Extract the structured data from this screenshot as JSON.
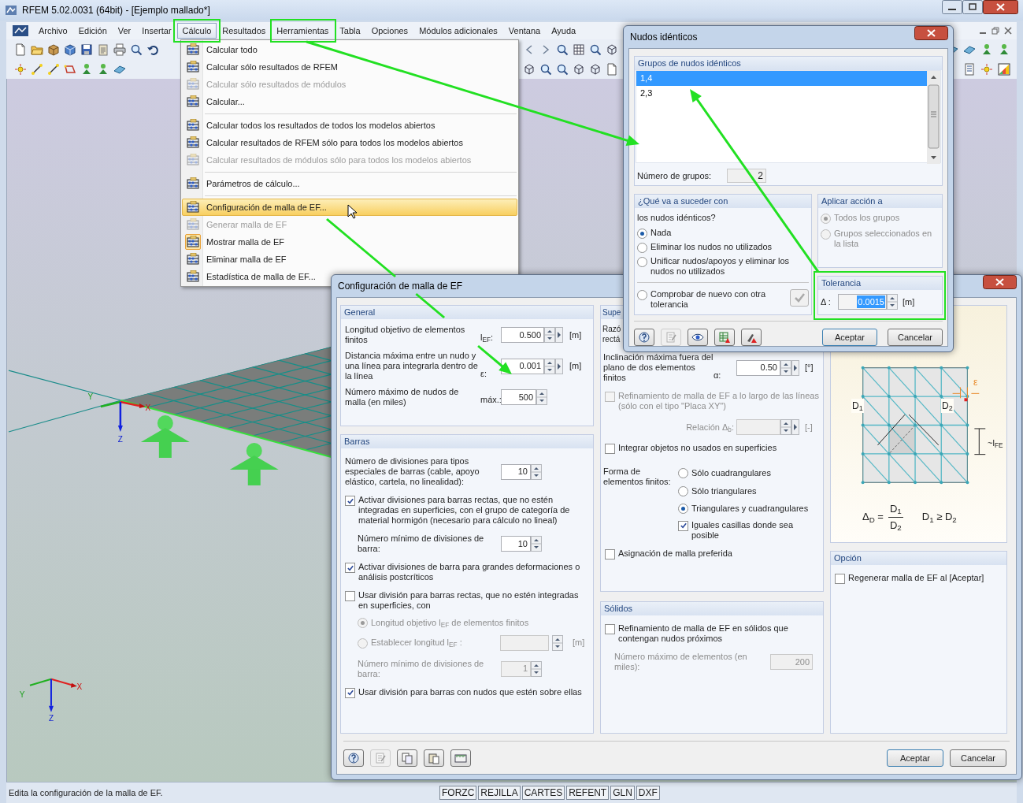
{
  "window": {
    "title": "RFEM 5.02.0031 (64bit) - [Ejemplo mallado*]"
  },
  "menu_bar": [
    {
      "label": "Archivo",
      "selected": false
    },
    {
      "label": "Edición",
      "selected": false
    },
    {
      "label": "Ver",
      "selected": false
    },
    {
      "label": "Insertar",
      "selected": false
    },
    {
      "label": "Cálculo",
      "selected": true
    },
    {
      "label": "Resultados",
      "selected": false
    },
    {
      "label": "Herramientas",
      "selected": false
    },
    {
      "label": "Tabla",
      "selected": false
    },
    {
      "label": "Opciones",
      "selected": false
    },
    {
      "label": "Módulos adicionales",
      "selected": false
    },
    {
      "label": "Ventana",
      "selected": false
    },
    {
      "label": "Ayuda",
      "selected": false
    }
  ],
  "calculation_menu": [
    {
      "kind": "item",
      "label": "Calcular todo",
      "disabled": false,
      "highlighted": false,
      "checked": false
    },
    {
      "kind": "item",
      "label": "Calcular sólo resultados de RFEM",
      "disabled": false,
      "highlighted": false,
      "checked": false
    },
    {
      "kind": "item",
      "label": "Calcular sólo resultados de módulos",
      "disabled": true,
      "highlighted": false,
      "checked": false
    },
    {
      "kind": "item",
      "label": "Calcular...",
      "disabled": false,
      "highlighted": false,
      "checked": false
    },
    {
      "kind": "separator"
    },
    {
      "kind": "item",
      "label": "Calcular todos los resultados de todos los modelos abiertos",
      "disabled": false,
      "highlighted": false,
      "checked": false
    },
    {
      "kind": "item",
      "label": "Calcular resultados de RFEM sólo para todos los modelos abiertos",
      "disabled": false,
      "highlighted": false,
      "checked": false
    },
    {
      "kind": "item",
      "label": "Calcular resultados de módulos sólo para todos los modelos abiertos",
      "disabled": true,
      "highlighted": false,
      "checked": false
    },
    {
      "kind": "separator"
    },
    {
      "kind": "item",
      "label": "Parámetros de cálculo...",
      "disabled": false,
      "highlighted": false,
      "checked": false
    },
    {
      "kind": "separator"
    },
    {
      "kind": "item",
      "label": "Configuración de malla de EF...",
      "disabled": false,
      "highlighted": true,
      "checked": false
    },
    {
      "kind": "item",
      "label": "Generar malla de EF",
      "disabled": true,
      "highlighted": false,
      "checked": false
    },
    {
      "kind": "item",
      "label": "Mostrar malla de EF",
      "disabled": false,
      "highlighted": false,
      "checked": true
    },
    {
      "kind": "item",
      "label": "Eliminar malla de EF",
      "disabled": false,
      "highlighted": false,
      "checked": false
    },
    {
      "kind": "item",
      "label": "Estadística de malla de EF...",
      "disabled": false,
      "highlighted": false,
      "checked": false
    }
  ],
  "viewport": {
    "axes": [
      {
        "x": "X",
        "y": "Y",
        "z": "Z"
      },
      {
        "x": "X",
        "y": "Y",
        "z": "Z"
      }
    ]
  },
  "mesh_dialog": {
    "title": "Configuración de malla de EF",
    "general": {
      "title": "General",
      "rows": [
        {
          "label": "Longitud objetivo de elementos finitos",
          "symbol": "l$_{EF}$:",
          "value": "0.500",
          "unit": "[m]"
        },
        {
          "label": "Distancia máxima entre un nudo y una línea para integrarla dentro de la línea",
          "symbol": "ε:",
          "value": "0.001",
          "unit": "[m]"
        },
        {
          "label": "Número máximo de nudos de malla (en miles)",
          "symbol": "máx.:",
          "value": "500"
        }
      ]
    },
    "bars": {
      "title": "Barras",
      "items": [
        {
          "kind": "number",
          "label": "Número de divisiones para tipos especiales de barras (cable, apoyo elástico, cartela, no linealidad):",
          "value": "10",
          "disabled": false,
          "indent": false
        },
        {
          "kind": "check",
          "label": "Activar divisiones para barras rectas, que no estén integradas en superficies, con el grupo de categoría de material hormigón (necesario para cálculo no lineal)",
          "checked": true,
          "disabled": false
        },
        {
          "kind": "number",
          "label": "Número mínimo de divisiones de barra:",
          "value": "10",
          "disabled": false,
          "indent": true
        },
        {
          "kind": "check",
          "label": "Activar divisiones de barra para grandes deformaciones o análisis postcríticos",
          "checked": true,
          "disabled": false
        },
        {
          "kind": "check",
          "label": "Usar división para barras rectas, que no estén integradas en superficies, con",
          "checked": false,
          "disabled": false
        },
        {
          "kind": "radio",
          "label": "Longitud objetivo l$_{EF}$ de elementos finitos",
          "selected": true,
          "disabled": true
        },
        {
          "kind": "radio",
          "label": "Establecer longitud l$_{EF}$ :",
          "selected": false,
          "disabled": true,
          "unit": "[m]"
        },
        {
          "kind": "number",
          "label": "Número mínimo de divisiones de barra:",
          "value": "1",
          "disabled": true,
          "indent": true
        },
        {
          "kind": "check",
          "label": "Usar división para barras con nudos que estén sobre ellas",
          "checked": true,
          "disabled": false
        }
      ]
    },
    "surfaces": {
      "title": "Supe",
      "cut_lines": [
        "Razó",
        "rectá"
      ],
      "items": [
        {
          "kind": "number",
          "label": "Inclinación máxima fuera del plano de dos elementos finitos",
          "symbol": "α:",
          "value": "0.50",
          "unit": "[°]",
          "disabled": false
        },
        {
          "kind": "check",
          "label": "Refinamiento de malla de EF a lo largo de las líneas (sólo con el tipo \"Placa XY\")",
          "checked": false,
          "disabled": true
        },
        {
          "kind": "number",
          "symbol": "Relación Δ$_{b}$:",
          "unit": "[-]",
          "disabled": true
        },
        {
          "kind": "check",
          "label": "Integrar objetos no usados en superficies",
          "checked": false,
          "disabled": false
        },
        {
          "kind": "radio_group",
          "label": "Forma de elementos finitos:",
          "options": [
            {
              "label": "Sólo cuadrangulares",
              "selected": false
            },
            {
              "label": "Sólo triangulares",
              "selected": false
            },
            {
              "label": "Triangulares y cuadrangulares",
              "selected": true
            }
          ],
          "check": {
            "label": "Iguales casillas donde sea posible",
            "checked": true
          }
        },
        {
          "kind": "check",
          "label": "Asignación de malla preferida",
          "checked": false,
          "disabled": false
        }
      ]
    },
    "solids": {
      "title": "Sólidos",
      "items": [
        {
          "kind": "check",
          "label": "Refinamiento de malla de EF en sólidos que contengan nudos próximos",
          "checked": false,
          "disabled": false
        },
        {
          "kind": "field",
          "label": "Número  máximo de elementos (en miles):",
          "value": "200",
          "disabled": true
        }
      ]
    },
    "diagram": {
      "d1": "D$_{1}$",
      "d2": "D$_{2}$",
      "length": "~l$_{FE}$",
      "epsilon": "ε",
      "formula_left": "Δ$_{D}$ =",
      "numerator": "D$_{1}$",
      "denominator": "D$_{2}$",
      "condition": "D$_{1}$ ≥ D$_{2}$"
    },
    "option": {
      "title": "Opción",
      "items": [
        {
          "kind": "check",
          "label": "Regenerar malla de EF al [Aceptar]",
          "checked": false,
          "disabled": false
        }
      ]
    },
    "buttons": [
      "Aceptar",
      "Cancelar"
    ]
  },
  "nodes_dialog": {
    "title": "Nudos idénticos",
    "groups": {
      "title": "Grupos de nudos idénticos",
      "items": [
        {
          "label": "1,4",
          "selected": true
        },
        {
          "label": "2,3",
          "selected": false
        }
      ],
      "count_label": "Número de grupos:",
      "count": "2"
    },
    "action": {
      "title": "¿Qué va a suceder con",
      "subtitle": "los nudos idénticos?",
      "options": [
        {
          "label": "Nada",
          "selected": true
        },
        {
          "label": "Eliminar los nudos no utilizados",
          "selected": false
        },
        {
          "label": "Unificar nudos/apoyos y eliminar los nudos no utilizados",
          "selected": false
        }
      ],
      "recheck": {
        "label": "Comprobar de nuevo con otra tolerancia",
        "selected": false
      }
    },
    "apply": {
      "title": "Aplicar acción a",
      "disabled": true,
      "options": [
        {
          "label": "Todos los grupos",
          "selected": true
        },
        {
          "label": "Grupos seleccionados en la lista",
          "selected": false
        }
      ]
    },
    "tolerance": {
      "title": "Tolerancia",
      "symbol": "Δ :",
      "value": "0.0015",
      "unit": "[m]"
    },
    "buttons": [
      "Aceptar",
      "Cancelar"
    ]
  },
  "status_bar": {
    "text": "Edita la configuración de la malla de EF.",
    "toggles": [
      "FORZC",
      "REJILLA",
      "CARTES",
      "REFENT",
      "GLN",
      "DXF"
    ]
  }
}
